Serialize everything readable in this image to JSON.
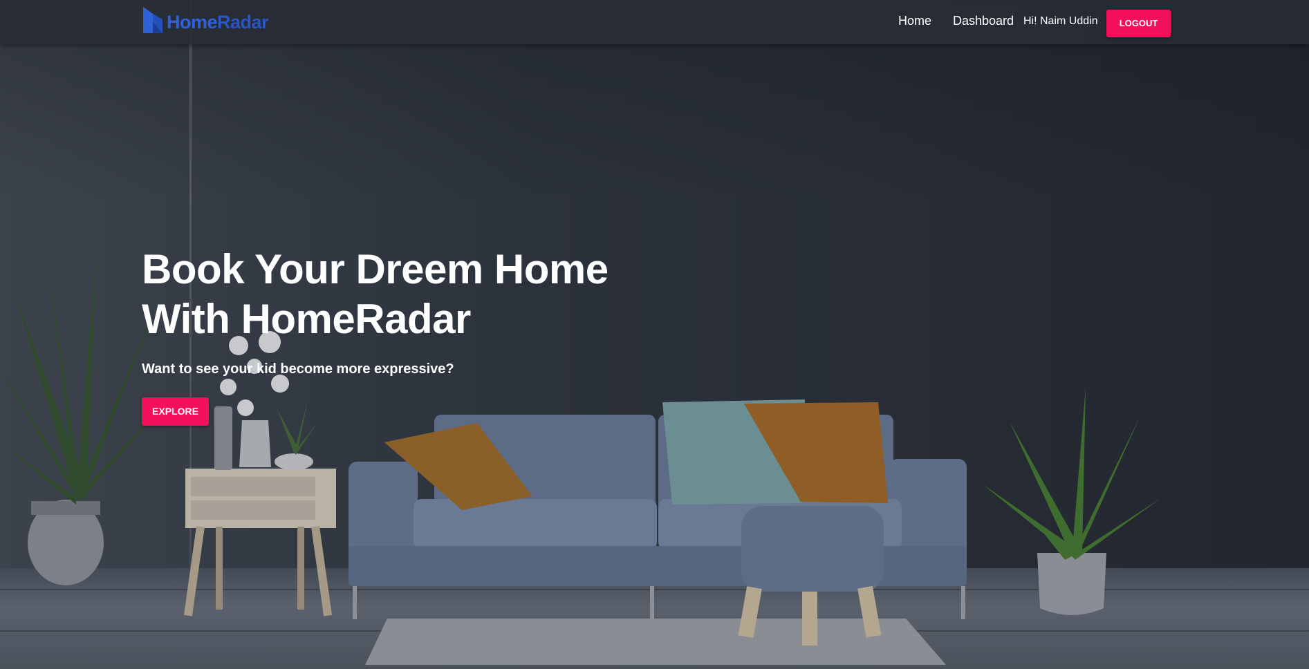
{
  "brand": {
    "name_part1": "Home",
    "name_part2": "Radar",
    "color": "#2f62d9"
  },
  "nav": {
    "links": [
      {
        "label": "Home"
      },
      {
        "label": "Dashboard"
      }
    ],
    "greeting": "Hi! Naim Uddin",
    "logout_label": "LOGOUT"
  },
  "hero": {
    "headline_line1": "Book Your Dreem Home",
    "headline_line2": "With HomeRadar",
    "subtitle": "Want to see your kid become more expressive?",
    "cta_label": "EXPLORE"
  },
  "colors": {
    "accent": "#f3105a",
    "background": "#2b313b"
  }
}
